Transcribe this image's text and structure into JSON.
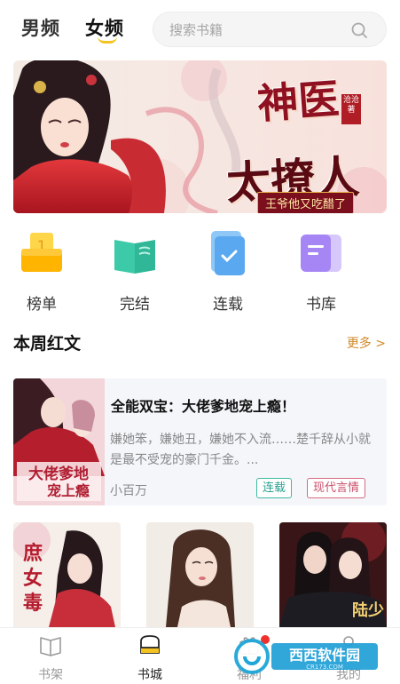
{
  "header": {
    "tabs": [
      {
        "label": "男频",
        "active": false
      },
      {
        "label": "女频",
        "active": true
      }
    ],
    "search": {
      "placeholder": "搜索书籍"
    }
  },
  "banner": {
    "title_line1": "神医",
    "title_line2": "太撩人",
    "subtitle": "王爷他又吃醋了",
    "seal": "沧沧著"
  },
  "quick_nav": [
    {
      "label": "榜单",
      "icon": "ranking-icon"
    },
    {
      "label": "完结",
      "icon": "completed-book-icon"
    },
    {
      "label": "连载",
      "icon": "serial-icon"
    },
    {
      "label": "书库",
      "icon": "library-icon"
    }
  ],
  "section": {
    "title": "本周红文",
    "more": "更多 >"
  },
  "featured_book": {
    "title": "全能双宝：大佬爹地宠上瘾！",
    "description": "嫌她笨，嫌她丑，嫌她不入流……楚千辞从小就是最不受宠的豪门千金。...",
    "author": "小百万",
    "status": "连载",
    "genre": "现代言情"
  },
  "grid_books": [
    {
      "cover": "book-cover-1"
    },
    {
      "cover": "book-cover-2"
    },
    {
      "cover": "book-cover-3"
    }
  ],
  "bottom_nav": [
    {
      "label": "书架",
      "icon": "bookshelf-icon"
    },
    {
      "label": "书城",
      "icon": "bookstore-icon",
      "active": true
    },
    {
      "label": "福利",
      "icon": "gift-icon"
    },
    {
      "label": "我的",
      "icon": "profile-icon"
    }
  ],
  "watermark": {
    "text": "西西软件园",
    "sub": "CR173.COM"
  },
  "colors": {
    "accent_yellow": "#f5c321",
    "more_link": "#d08a2a",
    "tag_status": "#2aa190",
    "tag_genre": "#c9506a",
    "badge_red": "#f0302d"
  }
}
